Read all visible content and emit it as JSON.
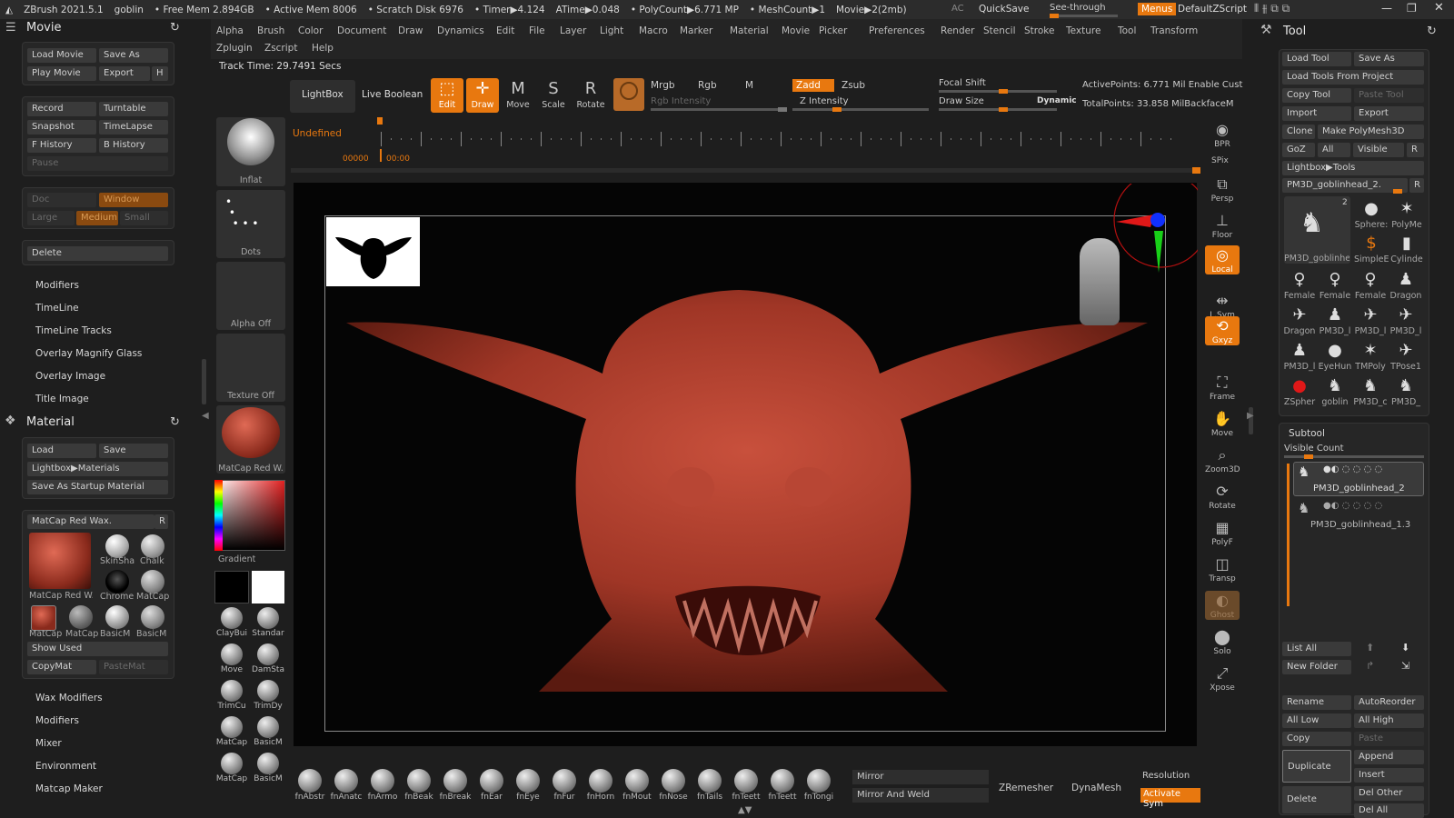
{
  "top_bar": {
    "app": "ZBrush 2021.5.1",
    "doc": "goblin",
    "stats": [
      "• Free Mem 2.894GB",
      "• Active Mem 8006",
      "• Scratch Disk 6976",
      "• Timer▶4.124",
      "ATime▶0.048",
      "• PolyCount▶6.771 MP",
      "• MeshCount▶1",
      "Movie▶2(2mb)"
    ],
    "ac": "AC",
    "quicksave": "QuickSave",
    "see_through": "See-through",
    "menus": "Menus",
    "script": "DefaultZScript"
  },
  "menu": {
    "row1": [
      "Alpha",
      "Brush",
      "Color",
      "Document",
      "Draw",
      "Dynamics",
      "Edit",
      "File",
      "Layer",
      "Light",
      "Macro",
      "Marker",
      "Material",
      "Movie",
      "Picker",
      "Preferences",
      "Render",
      "Stencil",
      "Stroke",
      "Texture",
      "Tool",
      "Transform"
    ],
    "row2": [
      "Zplugin",
      "Zscript",
      "Help"
    ],
    "track_time": "Track Time: 29.7491 Secs"
  },
  "movie": {
    "title": "Movie",
    "load_movie": "Load Movie",
    "save_as": "Save As",
    "play_movie": "Play Movie",
    "export": "Export",
    "h": "H",
    "record": "Record",
    "turntable": "Turntable",
    "snapshot": "Snapshot",
    "timelapse": "TimeLapse",
    "f_history": "F History",
    "b_history": "B History",
    "pause": "Pause",
    "doc": "Doc",
    "window": "Window",
    "large": "Large",
    "medium": "Medium",
    "small": "Small",
    "delete": "Delete",
    "sections": [
      "Modifiers",
      "TimeLine",
      "TimeLine Tracks",
      "Overlay Magnify Glass",
      "Overlay Image",
      "Title Image"
    ]
  },
  "material": {
    "title": "Material",
    "load": "Load",
    "save": "Save",
    "lightbox_materials": "Lightbox▶Materials",
    "save_startup": "Save As Startup Material",
    "current": "MatCap Red Wax.",
    "r": "R",
    "thumbs": [
      "MatCap Red W.",
      "SkinSha",
      "Chalk",
      "Chrome",
      "MatCap",
      "MatCap",
      "MatCap",
      "BasicM",
      "BasicM"
    ],
    "show_used": "Show Used",
    "copymat": "CopyMat",
    "pastemat": "PasteMat",
    "sections": [
      "Wax Modifiers",
      "Modifiers",
      "Mixer",
      "Environment",
      "Matcap Maker"
    ]
  },
  "shelf": {
    "brush": "Inflat",
    "stroke": "Dots",
    "alpha": "Alpha Off",
    "texture": "Texture Off",
    "material": "MatCap Red W.",
    "gradient": "Gradient",
    "brushes": [
      "ClayBui",
      "Standar",
      "Move",
      "DamSta",
      "TrimCu",
      "TrimDy",
      "MatCap",
      "BasicM",
      "MatCap",
      "BasicM"
    ]
  },
  "toolbar": {
    "lightbox": "LightBox",
    "live_boolean": "Live Boolean",
    "edit": "Edit",
    "draw": "Draw",
    "move": "Move",
    "scale": "Scale",
    "rotate": "Rotate",
    "mrgb": "Mrgb",
    "rgb": "Rgb",
    "m": "M",
    "rgb_intensity": "Rgb Intensity",
    "zadd": "Zadd",
    "zsub": "Zsub",
    "z_intensity": "Z Intensity",
    "focal_shift": "Focal Shift",
    "draw_size": "Draw Size",
    "dynamic": "Dynamic",
    "active_points": "ActivePoints: 6.771 Mil Enable Cust",
    "total_points": "TotalPoints: 33.858 MilBackfaceM",
    "undefined": "Undefined",
    "time_a": "00000",
    "time_b": "00:00"
  },
  "right_tools": [
    "BPR",
    "SPix",
    "Persp",
    "Floor",
    "Local",
    "L.Sym",
    "Gxyz",
    "Frame",
    "Move",
    "Zoom3D",
    "Rotate",
    "PolyF",
    "Transp",
    "Ghost",
    "Solo",
    "Xpose"
  ],
  "bottom": {
    "brushes": [
      "fnAbstr",
      "fnAnatc",
      "fnArmo",
      "fnBeak",
      "fnBreak",
      "fnEar",
      "fnEye",
      "fnFur",
      "fnHorn",
      "fnMout",
      "fnNose",
      "fnTails",
      "fnTeett",
      "fnTeett",
      "fnTongi"
    ],
    "mirror": "Mirror",
    "mirror_weld": "Mirror And Weld",
    "zremesher": "ZRemesher",
    "dynamesh": "DynaMesh",
    "resolution": "Resolution",
    "activate_sym": "Activate Sym"
  },
  "tool": {
    "title": "Tool",
    "load_tool": "Load Tool",
    "save_as": "Save As",
    "load_from_project": "Load Tools From Project",
    "copy_tool": "Copy Tool",
    "paste_tool": "Paste Tool",
    "import": "Import",
    "export": "Export",
    "clone": "Clone",
    "make_polymesh": "Make PolyMesh3D",
    "goz": "GoZ",
    "all": "All",
    "visible": "Visible",
    "r": "R",
    "lightbox_tools": "Lightbox▶Tools",
    "current": "PM3D_goblinhead_2.",
    "count": "2",
    "thumbs": [
      "Sphere:",
      "PolyMe",
      "SimpleE",
      "Cylinde",
      "Female",
      "Female",
      "Female",
      "Dragon",
      "Dragon",
      "PM3D_l",
      "PM3D_l",
      "PM3D_l",
      "PM3D_l",
      "EyeHun",
      "TMPoly",
      "TPose1",
      "ZSpher",
      "goblin",
      "PM3D_c",
      "PM3D_"
    ],
    "main_thumb": "PM3D_goblinhe"
  },
  "subtool": {
    "title": "Subtool",
    "visible_count": "Visible Count",
    "items": [
      "PM3D_goblinhead_2",
      "PM3D_goblinhead_1.3"
    ],
    "list_all": "List All",
    "new_folder": "New Folder",
    "rename": "Rename",
    "autoreorder": "AutoReorder",
    "all_low": "All Low",
    "all_high": "All High",
    "copy": "Copy",
    "paste": "Paste",
    "duplicate": "Duplicate",
    "append": "Append",
    "insert": "Insert",
    "delete": "Delete",
    "del_other": "Del Other",
    "del_all": "Del All"
  },
  "colors": {
    "accent": "#e8780f",
    "panel": "#262626",
    "wax": "#a9392a"
  }
}
